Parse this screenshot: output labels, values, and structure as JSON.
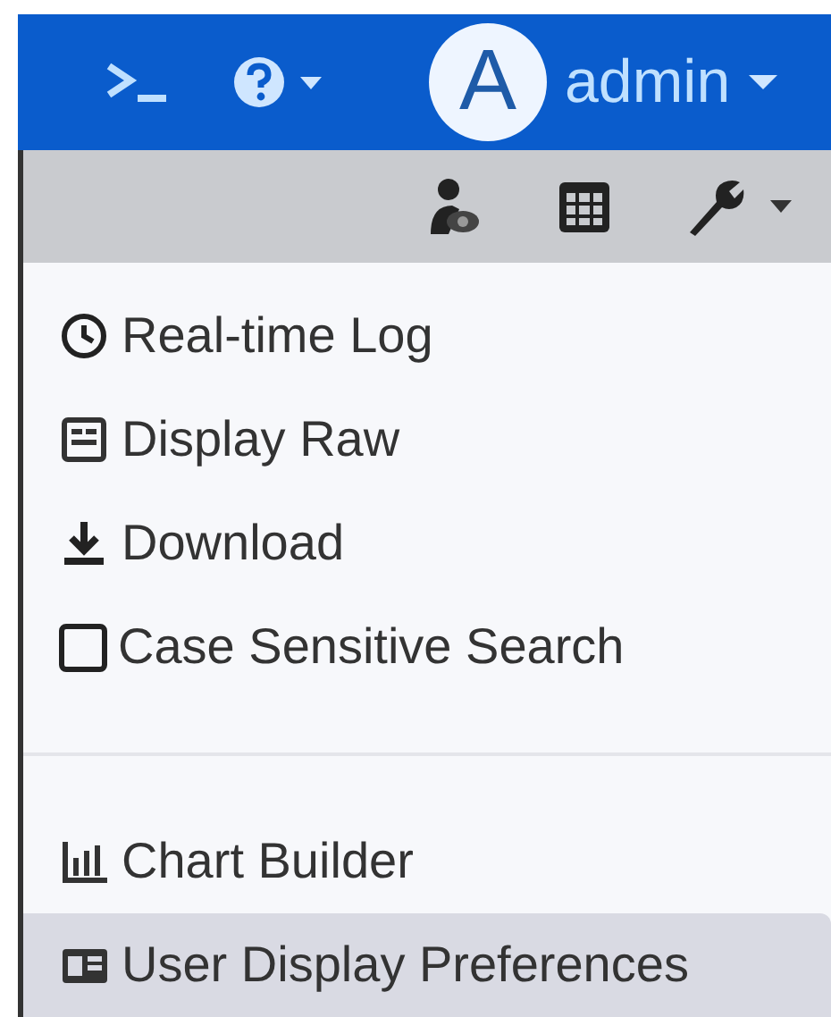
{
  "header": {
    "avatar_letter": "A",
    "user_name": "admin"
  },
  "menu": {
    "groups": [
      [
        {
          "kind": "clock",
          "label": "Real-time Log",
          "selected": false
        },
        {
          "kind": "raw",
          "label": "Display Raw",
          "selected": false
        },
        {
          "kind": "download",
          "label": "Download",
          "selected": false
        },
        {
          "kind": "checkbox",
          "label": "Case Sensitive Search",
          "checked": false,
          "selected": false
        }
      ],
      [
        {
          "kind": "chart",
          "label": "Chart Builder",
          "selected": false
        },
        {
          "kind": "card",
          "label": "User Display Preferences",
          "selected": true
        }
      ]
    ]
  }
}
